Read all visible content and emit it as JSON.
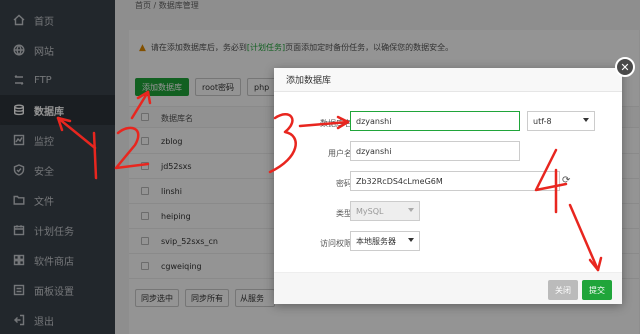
{
  "sidebar": {
    "items": [
      {
        "label": "首页",
        "icon": "home-icon"
      },
      {
        "label": "网站",
        "icon": "globe-icon"
      },
      {
        "label": "FTP",
        "icon": "ftp-icon"
      },
      {
        "label": "数据库",
        "icon": "database-icon",
        "active": true
      },
      {
        "label": "监控",
        "icon": "monitor-icon"
      },
      {
        "label": "安全",
        "icon": "shield-icon"
      },
      {
        "label": "文件",
        "icon": "folder-icon"
      },
      {
        "label": "计划任务",
        "icon": "calendar-icon"
      },
      {
        "label": "软件商店",
        "icon": "store-icon"
      },
      {
        "label": "面板设置",
        "icon": "settings-icon"
      },
      {
        "label": "退出",
        "icon": "logout-icon"
      }
    ]
  },
  "breadcrumb": "首页 / 数据库管理",
  "notice": {
    "before": "请在添加数据库后，务必到",
    "link": "[计划任务]",
    "after": "页面添加定时备份任务，以确保您的数据安全。"
  },
  "toolbar": {
    "add_db": "添加数据库",
    "root_pwd": "root密码",
    "php": "php"
  },
  "table": {
    "header_name": "数据库名",
    "rows": [
      "zblog",
      "jd52sxs",
      "linshi",
      "heiping",
      "svip_52sxs_cn",
      "cgweiqing"
    ]
  },
  "bottom_buttons": {
    "sync_selected": "同步选中",
    "sync_all": "同步所有",
    "from_server": "从服务"
  },
  "modal": {
    "title": "添加数据库",
    "db_name_label": "数据库名",
    "db_name_value": "dzyanshi",
    "charset_value": "utf-8",
    "user_label": "用户名",
    "user_value": "dzyanshi",
    "password_label": "密码",
    "password_value": "Zb32RcDS4cLmeG6M",
    "type_label": "类型",
    "type_value": "MySQL",
    "access_label": "访问权限",
    "access_value": "本地服务器",
    "cancel": "关闭",
    "submit": "提交"
  },
  "colors": {
    "accent": "#20a53a",
    "sidebar": "#3c444d",
    "annotation": "#e8261f"
  }
}
